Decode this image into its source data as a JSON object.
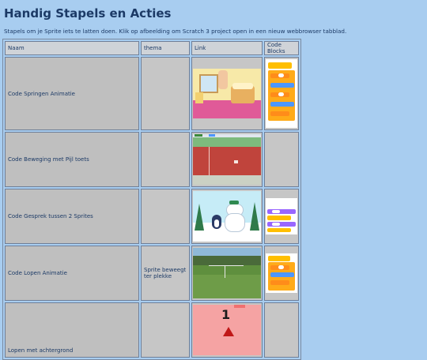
{
  "page": {
    "title": "Handig Stapels en Acties",
    "intro": "Stapels om je Sprite iets te latten doen. Klik op afbeelding om Scratch 3 project open in een nieuw webbrowser tabblad."
  },
  "table": {
    "headers": [
      "Naam",
      "thema",
      "Link",
      "Code Blocks"
    ],
    "rows": [
      {
        "name": "Code Springen Animatie",
        "theme": "",
        "link_icon": "bedroom-scene-thumbnail",
        "code_icon": "code-blocks-thumbnail"
      },
      {
        "name": "Code Beweging met Pijl toets",
        "theme": "",
        "link_icon": "red-field-thumbnail",
        "code_icon": ""
      },
      {
        "name": "Code Gesprek tussen 2 Sprites",
        "theme": "",
        "link_icon": "winter-penguin-thumbnail",
        "code_icon": "code-blocks-thumbnail"
      },
      {
        "name": "Code Lopen Animatie",
        "theme": "Sprite beweegt ter plekke",
        "link_icon": "football-field-thumbnail",
        "code_icon": "code-blocks-thumbnail"
      },
      {
        "name": "Lopen met achtergrond",
        "theme": "",
        "link_icon": "number-one-thumbnail",
        "code_icon": ""
      }
    ]
  },
  "thumb_text": {
    "counter": "1"
  }
}
